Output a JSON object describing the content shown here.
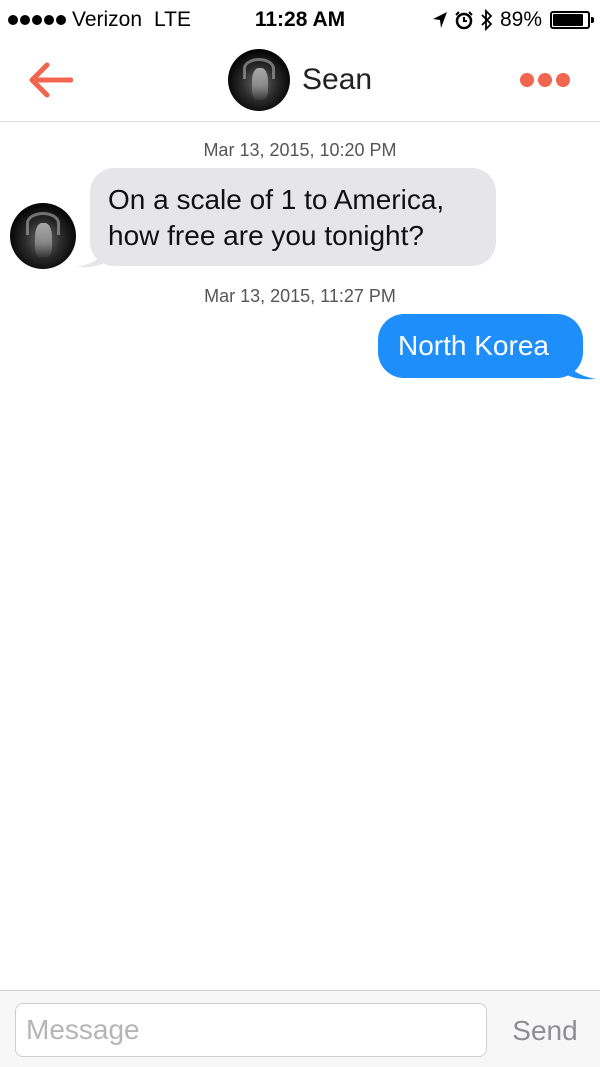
{
  "status_bar": {
    "carrier": "Verizon",
    "network": "LTE",
    "time": "11:28 AM",
    "battery_percent": "89%",
    "battery_level": 0.89,
    "signal_bars": 5,
    "icons": [
      "location-icon",
      "alarm-icon",
      "bluetooth-icon",
      "battery-icon"
    ]
  },
  "header": {
    "contact_name": "Sean",
    "back_icon": "arrow-left-icon",
    "more_icon": "more-dots-icon"
  },
  "conversation": {
    "messages": [
      {
        "timestamp": "Mar 13, 2015, 10:20 PM",
        "direction": "incoming",
        "lines": [
          "On a scale of 1 to America,",
          "how free are you tonight?"
        ]
      },
      {
        "timestamp": "Mar 13, 2015, 11:27 PM",
        "direction": "outgoing",
        "lines": [
          "North Korea"
        ]
      }
    ]
  },
  "composer": {
    "placeholder": "Message",
    "value": "",
    "send_label": "Send"
  },
  "colors": {
    "accent": "#f2654f",
    "outgoing_bubble": "#1e8efa",
    "incoming_bubble": "#e5e5ea"
  }
}
